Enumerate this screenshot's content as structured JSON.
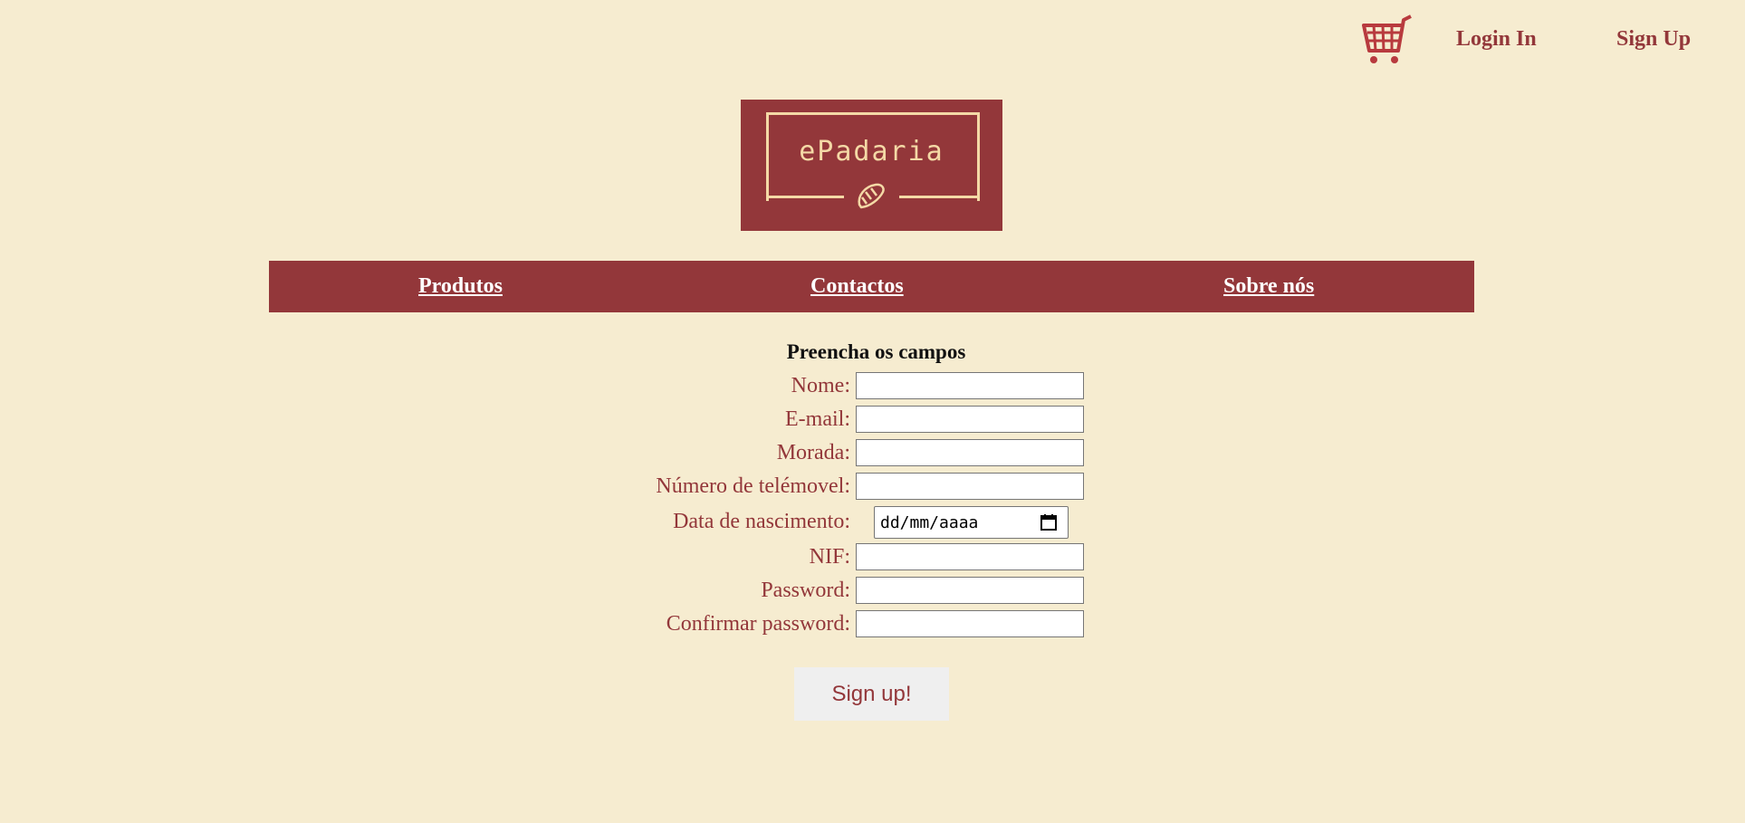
{
  "header": {
    "cart_icon": "shopping-cart-icon",
    "login_label": "Login In",
    "signup_label": "Sign Up"
  },
  "logo": {
    "text": "ePadaria",
    "icon": "croissant-icon"
  },
  "nav": {
    "items": [
      {
        "label": "Produtos"
      },
      {
        "label": "Contactos"
      },
      {
        "label": "Sobre nós"
      }
    ]
  },
  "form": {
    "title": "Preencha os campos",
    "fields": [
      {
        "label": "Nome:",
        "value": ""
      },
      {
        "label": "E-mail:",
        "value": ""
      },
      {
        "label": "Morada:",
        "value": ""
      },
      {
        "label": "Número de telémovel:",
        "value": ""
      },
      {
        "label": "Data de nascimento:",
        "placeholder": "dd/mm/aaaa"
      },
      {
        "label": "NIF:",
        "value": ""
      },
      {
        "label": "Password:",
        "value": ""
      },
      {
        "label": "Confirmar password:",
        "value": ""
      }
    ],
    "submit_label": "Sign up!"
  },
  "colors": {
    "background": "#f6ecd0",
    "brand": "#93373a",
    "logo_accent": "#f4d9a6"
  }
}
